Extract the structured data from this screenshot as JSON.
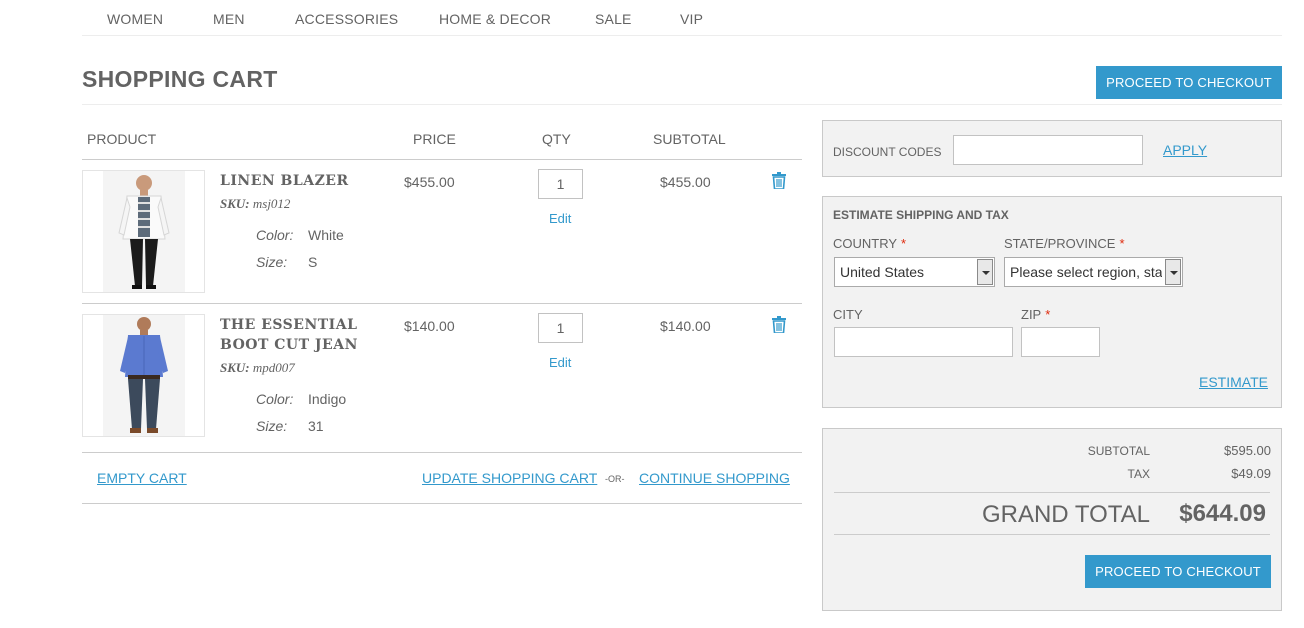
{
  "nav": {
    "items": [
      "WOMEN",
      "MEN",
      "ACCESSORIES",
      "HOME & DECOR",
      "SALE",
      "VIP"
    ]
  },
  "page": {
    "title": "SHOPPING CART",
    "checkout_label": "PROCEED TO CHECKOUT"
  },
  "table": {
    "headers": [
      "PRODUCT",
      "PRICE",
      "QTY",
      "SUBTOTAL"
    ],
    "sku_label": "SKU:",
    "edit_label": "Edit",
    "items": [
      {
        "name_lines": [
          "LINEN BLAZER"
        ],
        "sku": "msj012",
        "options": [
          {
            "label": "Color:",
            "value": "White"
          },
          {
            "label": "Size:",
            "value": "S"
          }
        ],
        "price": "$455.00",
        "qty": "1",
        "subtotal": "$455.00",
        "image_icon": "white-blazer-product-photo"
      },
      {
        "name_lines": [
          "THE ESSENTIAL",
          "BOOT CUT JEAN"
        ],
        "sku": "mpd007",
        "options": [
          {
            "label": "Color:",
            "value": "Indigo"
          },
          {
            "label": "Size:",
            "value": "31"
          }
        ],
        "price": "$140.00",
        "qty": "1",
        "subtotal": "$140.00",
        "image_icon": "blue-shirt-jeans-product-photo"
      }
    ]
  },
  "actions": {
    "empty_cart": "EMPTY CART",
    "update_cart": "UPDATE SHOPPING CART",
    "or": "-OR-",
    "continue": "CONTINUE SHOPPING"
  },
  "discount": {
    "label": "DISCOUNT CODES",
    "value": "",
    "apply": "APPLY"
  },
  "shipping": {
    "title": "ESTIMATE SHIPPING AND TAX",
    "country_label": "COUNTRY",
    "country_value": "United States",
    "state_label": "STATE/PROVINCE",
    "state_value": "Please select region, state or province",
    "city_label": "CITY",
    "city_value": "",
    "zip_label": "ZIP",
    "zip_value": "",
    "required_mark": "*",
    "estimate": "ESTIMATE"
  },
  "totals": {
    "subtotal_label": "SUBTOTAL",
    "subtotal": "$595.00",
    "tax_label": "TAX",
    "tax": "$49.09",
    "grand_label": "GRAND TOTAL",
    "grand": "$644.09"
  },
  "colors": {
    "accent": "#3399cc",
    "required": "#df280a",
    "text": "#636363",
    "panel_bg": "#f2f2f2"
  }
}
